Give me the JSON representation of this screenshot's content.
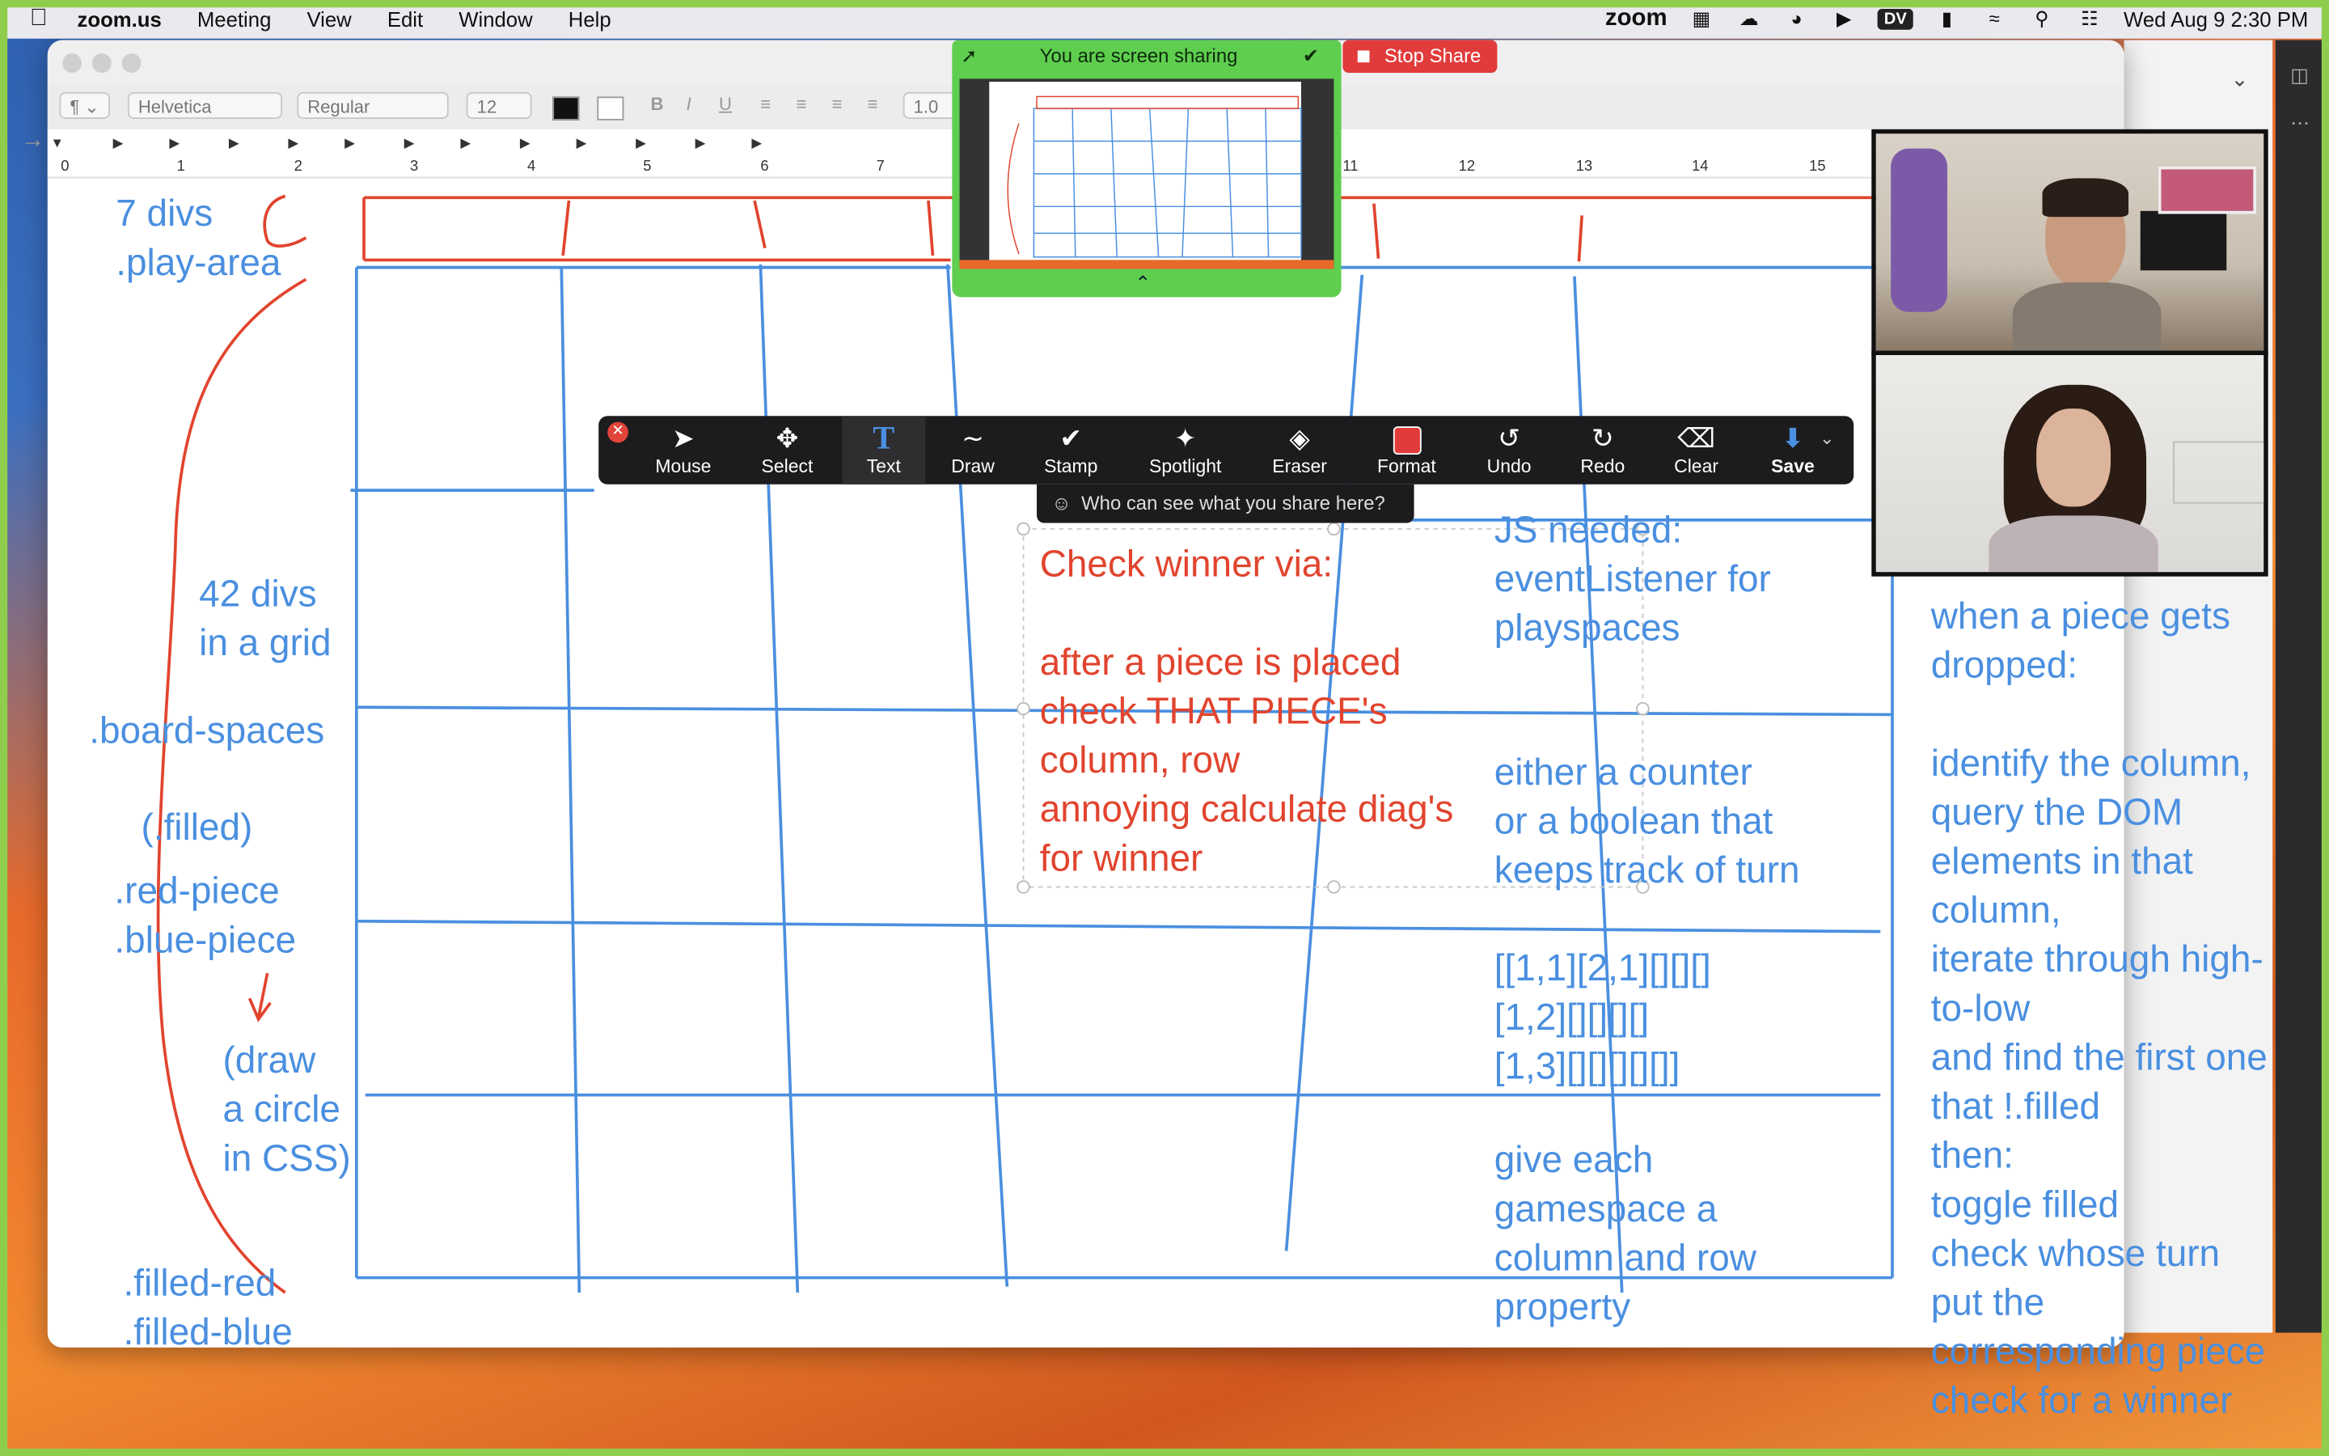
{
  "menubar": {
    "app": "zoom.us",
    "items": [
      "Meeting",
      "View",
      "Edit",
      "Window",
      "Help"
    ],
    "zoom_brand": "zoom",
    "dv_badge": "DV",
    "clock": "Wed Aug 9  2:30 PM"
  },
  "format_bar": {
    "paragraph": "¶",
    "font": "Helvetica",
    "style": "Regular",
    "size": "12",
    "bold": "B",
    "italic": "I",
    "underline": "U",
    "spacing": "1.0"
  },
  "ruler": {
    "numbers": [
      "0",
      "1",
      "2",
      "3",
      "4",
      "5",
      "6",
      "7",
      "11",
      "12",
      "13",
      "14",
      "15"
    ]
  },
  "share": {
    "banner": "You are screen sharing",
    "stop_label": "Stop Share"
  },
  "annotate": {
    "tools": [
      {
        "label": "Mouse",
        "icon": "cursor-icon"
      },
      {
        "label": "Select",
        "icon": "move-icon"
      },
      {
        "label": "Text",
        "icon": "text-icon"
      },
      {
        "label": "Draw",
        "icon": "draw-icon"
      },
      {
        "label": "Stamp",
        "icon": "checkmark-icon"
      },
      {
        "label": "Spotlight",
        "icon": "spotlight-icon"
      },
      {
        "label": "Eraser",
        "icon": "eraser-icon"
      },
      {
        "label": "Format",
        "icon": "format-icon"
      },
      {
        "label": "Undo",
        "icon": "undo-icon"
      },
      {
        "label": "Redo",
        "icon": "redo-icon"
      },
      {
        "label": "Clear",
        "icon": "trash-icon"
      },
      {
        "label": "Save",
        "icon": "save-icon"
      }
    ],
    "who_can_see": "Who can see what you share here?"
  },
  "notes": {
    "seven_divs": "7 divs\n.play-area",
    "grid_divs": "42 divs\nin a grid",
    "board_spaces": ".board-spaces",
    "filled": "(.filled)",
    "pieces": ".red-piece\n.blue-piece",
    "draw_circle": "(draw\na circle\nin CSS)",
    "filled_classes": ".filled-red\n.filled-blue",
    "check_winner": "Check winner via:\n\nafter a piece is placed\ncheck THAT PIECE's\ncolumn, row\nannoying calculate diag's\nfor winner",
    "js_needed": "JS needed:\neventListener for\nplayspaces",
    "counter": "either a counter\nor a boolean that\nkeeps track of turn",
    "array": "[[1,1][2,1][][][]\n[1,2][][][][]\n[1,3][][][][][]]",
    "gamespace": "give each\ngamespace a\ncolumn and row\nproperty",
    "piece_dropped": "when a piece gets\ndropped:\n\nidentify the column,\nquery the DOM\nelements in that\ncolumn,\niterate through high-\nto-low\nand find the first one\nthat !.filled\nthen:\ntoggle filled\ncheck whose turn\nput the\ncorresponding piece\ncheck for a winner"
  },
  "colors": {
    "annotation_blue": "#4a8fe0",
    "annotation_red": "#e1442e",
    "share_green": "#5fce4f",
    "stop_red": "#e23b3b"
  }
}
